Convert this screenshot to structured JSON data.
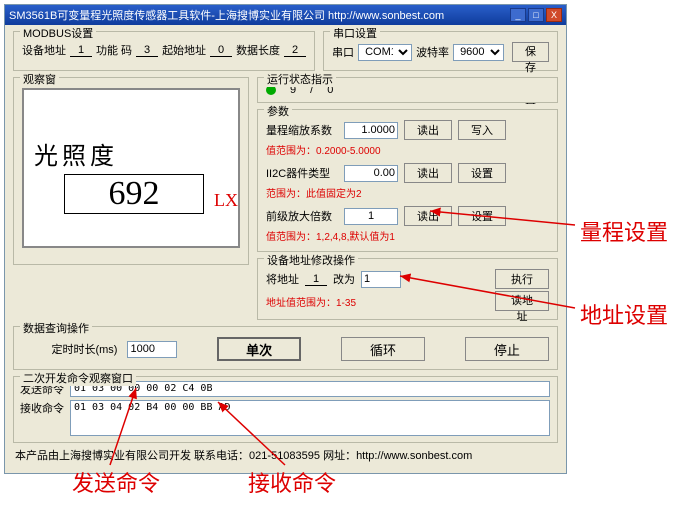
{
  "window": {
    "title": "SM3561B可变量程光照度传感器工具软件-上海搜博实业有限公司 http://www.sonbest.com",
    "min": "_",
    "max": "□",
    "close": "X"
  },
  "modbus": {
    "group": "MODBUS设置",
    "addr_label": "设备地址",
    "addr": "1",
    "func_label": "功能 码",
    "func": "3",
    "start_label": "起始地址",
    "start": "0",
    "len_label": "数据长度",
    "len": "2"
  },
  "serial": {
    "group": "串口设置",
    "port_label": "串口",
    "port": "COM1",
    "baud_label": "波特率",
    "baud": "9600",
    "save_btn": "保存设置"
  },
  "observe": {
    "group": "观察窗",
    "label": "光照度",
    "value": "692",
    "unit": "LX"
  },
  "status": {
    "group": "运行状态指示",
    "text1": "9",
    "text2": "/",
    "text3": "0"
  },
  "params": {
    "group": "参数",
    "scale_label": "量程缩放系数",
    "scale_value": "1.0000",
    "read_btn": "读出",
    "write_btn": "写入",
    "scale_hint": "值范围为：0.2000-5.0000",
    "iic_label": "II2C器件类型",
    "iic_value": "0.00",
    "set_btn": "设置",
    "iic_hint": "范围为：此值固定为2",
    "preamp_label": "前级放大倍数",
    "preamp_value": "1",
    "preamp_hint": "值范围为：1,2,4,8,默认值为1"
  },
  "addrmod": {
    "group": "设备地址修改操作",
    "from_label": "将地址",
    "from_value": "1",
    "to_label": "改为",
    "to_value": "1",
    "exec_btn": "执行",
    "hint": "地址值范围为：1-35",
    "read_addr_btn": "读地址"
  },
  "query": {
    "group": "数据查询操作",
    "timer_label": "定时时长(ms)",
    "timer_value": "1000",
    "single_btn": "单次",
    "loop_btn": "循环",
    "stop_btn": "停止"
  },
  "seccmd": {
    "group": "二次开发命令观察窗口",
    "send_label": "发送命令",
    "send_val": "01 03 00 00 00 02 C4 0B",
    "recv_label": "接收命令",
    "recv_val": "01 03 04 02 B4 00 00 BB AD"
  },
  "footer": "本产品由上海搜博实业有限公司开发 联系电话：021-51083595 网址：http://www.sonbest.com",
  "annotations": {
    "range": "量程设置",
    "addr": "地址设置",
    "send": "发送命令",
    "recv": "接收命令"
  }
}
